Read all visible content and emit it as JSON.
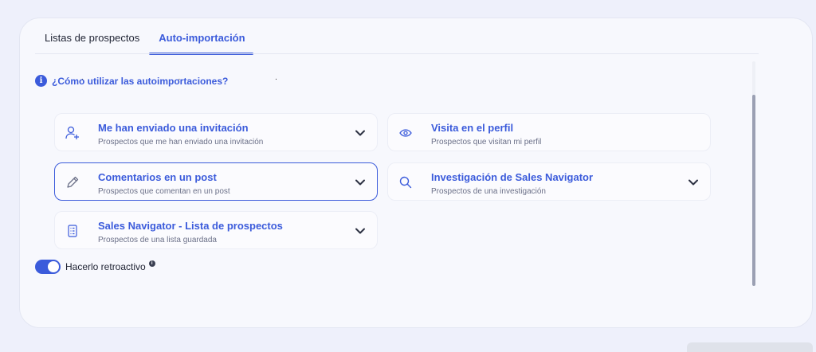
{
  "tabs": [
    {
      "label": "Listas de prospectos",
      "active": false
    },
    {
      "label": "Auto-importación",
      "active": true
    }
  ],
  "help": {
    "label": "¿Cómo utilizar las autoimportaciones?"
  },
  "cards": [
    {
      "title": "Me han enviado una invitación",
      "subtitle": "Prospectos que me han enviado una invitación",
      "icon": "user-add-icon",
      "expandable": true
    },
    {
      "title": "Visita en el perfil",
      "subtitle": "Prospectos que visitan mi perfil",
      "icon": "eye-icon",
      "expandable": false
    },
    {
      "title": "Comentarios en un post",
      "subtitle": "Prospectos que comentan en un post",
      "icon": "pencil-icon",
      "expandable": true,
      "selected": true
    },
    {
      "title": "Investigación de Sales Navigator",
      "subtitle": "Prospectos de una investigación",
      "icon": "search-icon",
      "expandable": true
    },
    {
      "title": "Sales Navigator - Lista de prospectos",
      "subtitle": "Prospectos de una lista guardada",
      "icon": "list-icon",
      "expandable": true
    }
  ],
  "retroactive": {
    "label": "Hacerlo retroactivo",
    "enabled": true
  },
  "colors": {
    "accent": "#3b5bdb",
    "background": "#eef0fb",
    "panel": "#f7f8fd"
  }
}
